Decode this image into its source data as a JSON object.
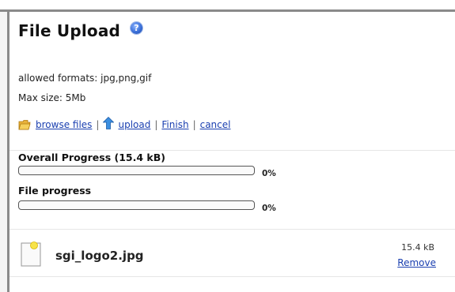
{
  "dialog": {
    "title": "File Upload",
    "help_icon": "help-question-icon"
  },
  "info": {
    "allowed_formats": "allowed formats: jpg,png,gif",
    "max_size": "Max size: 5Mb"
  },
  "actions": {
    "browse_label": "browse files",
    "upload_label": "upload",
    "finish_label": "Finish",
    "cancel_label": "cancel",
    "separator": "|",
    "browse_icon": "folder-icon",
    "upload_icon": "upload-arrow-icon"
  },
  "progress": {
    "overall_label": "Overall Progress (15.4 kB)",
    "overall_percent_text": "0%",
    "overall_value": 0,
    "file_label": "File progress",
    "file_percent_text": "0%",
    "file_value": 0
  },
  "files": [
    {
      "name": "sgi_logo2.jpg",
      "size": "15.4 kB",
      "remove_label": "Remove",
      "icon": "image-file-icon"
    }
  ],
  "colors": {
    "link": "#1a3fb0",
    "frame": "#8a8a8a",
    "progress_fill": "#4a86d8"
  }
}
